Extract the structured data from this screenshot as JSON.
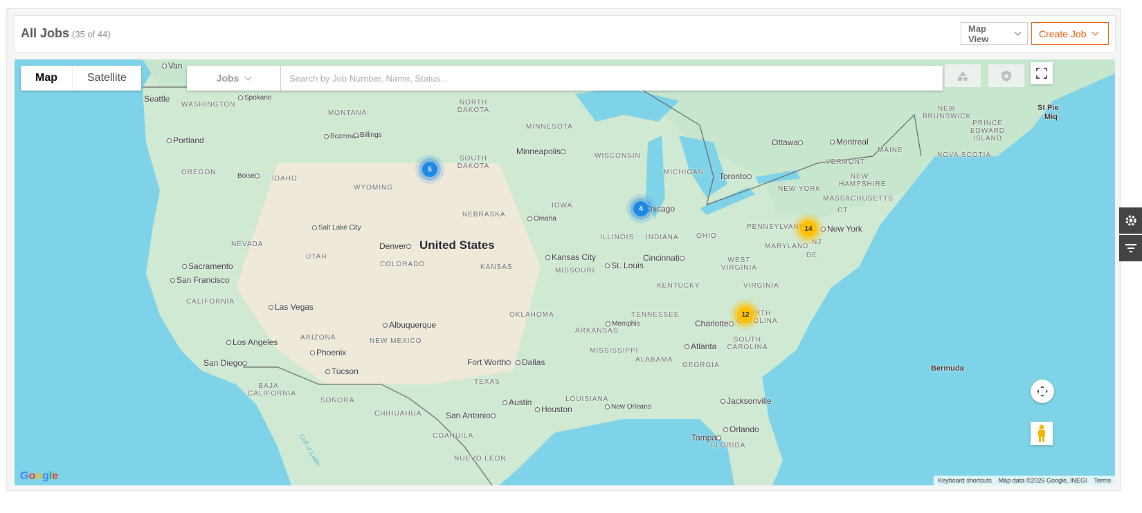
{
  "header": {
    "title": "All Jobs",
    "count": "(35 of 44)",
    "map_view_label": "Map View",
    "create_job_label": "Create Job"
  },
  "map": {
    "type_toggle": {
      "map": "Map",
      "satellite": "Satellite",
      "active": "Map"
    },
    "search": {
      "select_label": "Jobs",
      "placeholder": "Search by Job Number, Name, Status..."
    },
    "clusters": [
      {
        "count": "5",
        "color": "blue"
      },
      {
        "count": "4",
        "color": "blue"
      },
      {
        "count": "14",
        "color": "yellow"
      },
      {
        "count": "12",
        "color": "yellow"
      }
    ],
    "country_label": "United States",
    "cities": [
      "Seattle",
      "Spokane",
      "Portland",
      "Boise",
      "Bozeman",
      "Billings",
      "Salt Lake City",
      "Sacramento",
      "San Francisco",
      "Las Vegas",
      "Los Angeles",
      "San Diego",
      "Phoenix",
      "Tucson",
      "Albuquerque",
      "Denver",
      "Omaha",
      "Kansas City",
      "Minneapolis",
      "Chicago",
      "St. Louis",
      "Cincinnati",
      "Memphis",
      "Atlanta",
      "Charlotte",
      "Jacksonville",
      "Orlando",
      "Tampa",
      "New Orleans",
      "Houston",
      "Austin",
      "San Antonio",
      "Fort Worth",
      "Dallas",
      "Toronto",
      "Ottawa",
      "Montreal",
      "New York",
      "Bermuda"
    ],
    "states": [
      "WASHINGTON",
      "MONTANA",
      "NORTH DAKOTA",
      "SOUTH DAKOTA",
      "MINNESOTA",
      "WISCONSIN",
      "MICHIGAN",
      "OREGON",
      "IDAHO",
      "WYOMING",
      "NEBRASKA",
      "IOWA",
      "ILLINOIS",
      "INDIANA",
      "OHIO",
      "PENNSYLVANIA",
      "NEW YORK",
      "NEVADA",
      "UTAH",
      "COLORADO",
      "KANSAS",
      "MISSOURI",
      "KENTUCKY",
      "WEST VIRGINIA",
      "VIRGINIA",
      "MARYLAND",
      "NJ",
      "DE",
      "CT",
      "CALIFORNIA",
      "ARIZONA",
      "NEW MEXICO",
      "OKLAHOMA",
      "ARKANSAS",
      "TENNESSEE",
      "NORTH CAROLINA",
      "SOUTH CAROLINA",
      "MISSISSIPPI",
      "ALABAMA",
      "GEORGIA",
      "LOUISIANA",
      "TEXAS",
      "FLORIDA",
      "BAJA CALIFORNIA",
      "SONORA",
      "CHIHUAHUA",
      "COAHUILA",
      "NUEVO LEON",
      "VERMONT",
      "NEW HAMPSHIRE",
      "MASSACHUSETTS",
      "MAINE",
      "NEW BRUNSWICK",
      "PRINCE EDWARD ISLAND",
      "NOVA SCOTIA"
    ],
    "misc_labels": {
      "van": "Van",
      "st_pie": "St Pie",
      "miq": "Miq",
      "gulf": "Gulf of Califo"
    },
    "attribution": {
      "keyboard": "Keyboard shortcuts",
      "data": "Map data ©2026 Google, INEGI",
      "terms": "Terms"
    },
    "logo": "Google"
  },
  "colors": {
    "accent": "#e8590c",
    "water": "#7fd3e8",
    "cluster_blue": "#1e88e5",
    "cluster_yellow": "#ffc107"
  }
}
